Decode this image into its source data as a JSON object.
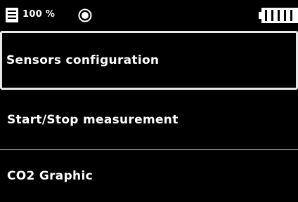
{
  "status_bar": {
    "storage_icon": "storage-icon",
    "storage_percent": "100 %",
    "recording_icon": "record-icon",
    "battery_icon": "battery-full-icon"
  },
  "menu": {
    "items": [
      {
        "label": "Sensors configuration",
        "selected": true
      },
      {
        "label": "Start/Stop measurement",
        "selected": false
      },
      {
        "label": "CO2 Graphic",
        "selected": false
      }
    ]
  },
  "colors": {
    "background": "#000000",
    "foreground": "#ffffff",
    "selection_border": "#e8e8e8"
  }
}
